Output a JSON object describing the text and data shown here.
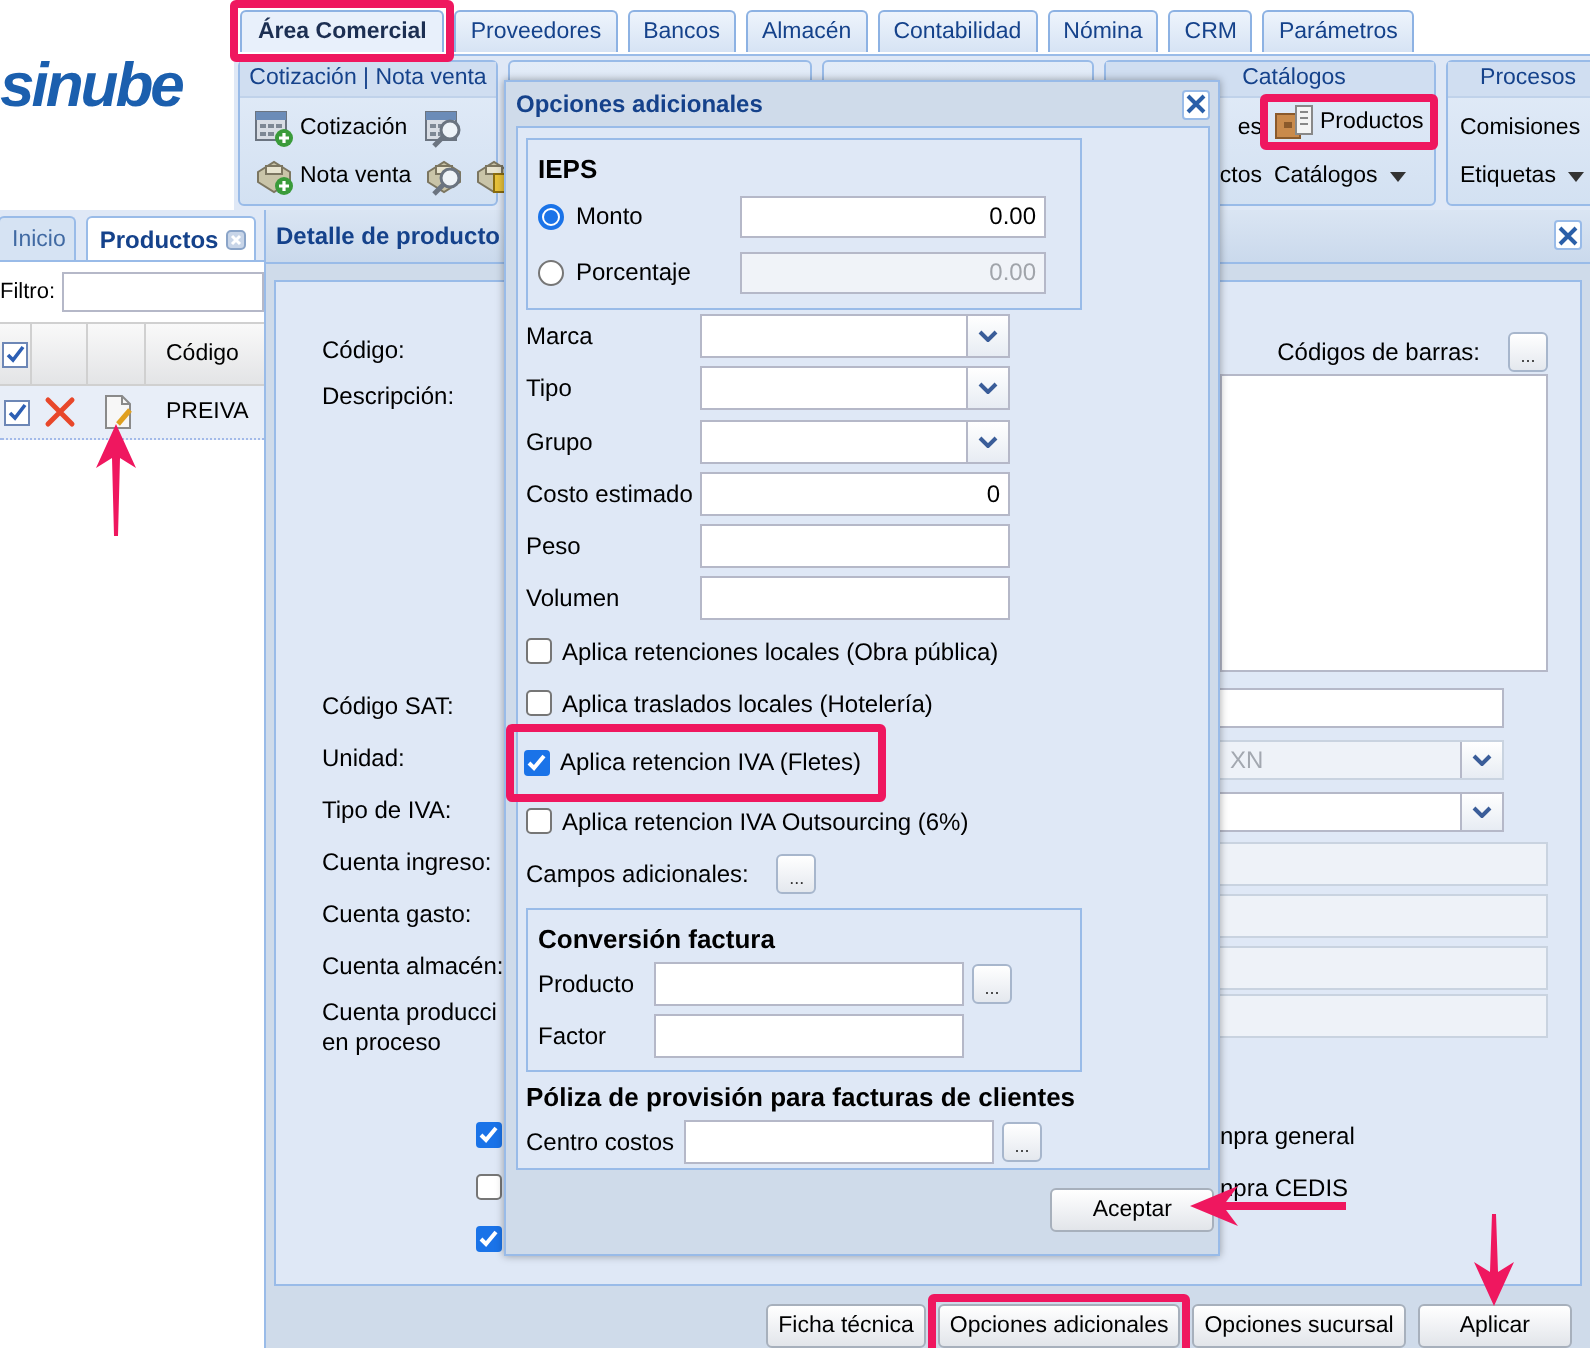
{
  "logo": "sinube",
  "main_tabs": [
    {
      "label": "Área Comercial",
      "selected": true,
      "highlighted": true
    },
    {
      "label": "Proveedores",
      "selected": false,
      "highlighted": false
    },
    {
      "label": "Bancos",
      "selected": false,
      "highlighted": false
    },
    {
      "label": "Almacén",
      "selected": false,
      "highlighted": false
    },
    {
      "label": "Contabilidad",
      "selected": false,
      "highlighted": false
    },
    {
      "label": "Nómina",
      "selected": false,
      "highlighted": false
    },
    {
      "label": "CRM",
      "selected": false,
      "highlighted": false
    },
    {
      "label": "Parámetros",
      "selected": false,
      "highlighted": false
    }
  ],
  "ribbon": {
    "groups": [
      {
        "kind": "quotes",
        "title": "Cotización | Nota venta",
        "items": [
          {
            "kind": "quote",
            "label": "Cotización",
            "highlighted": false
          },
          {
            "kind": "quote-search",
            "highlighted": false
          },
          {
            "kind": "sale",
            "label": "Nota venta",
            "highlighted": false
          },
          {
            "kind": "sale-search",
            "highlighted": false
          },
          {
            "kind": "sale-print",
            "highlighted": false
          }
        ]
      },
      {
        "kind": "covered"
      },
      {
        "kind": "covered"
      },
      {
        "kind": "catalogs",
        "title": "Catálogos",
        "items": [
          {
            "kind": "text",
            "label": "es",
            "highlighted": false
          },
          {
            "kind": "product",
            "label": "Productos",
            "highlighted": true
          },
          {
            "kind": "text",
            "label": "ctos",
            "highlighted": false
          },
          {
            "kind": "menu",
            "label": "Catálogos",
            "highlighted": false
          }
        ]
      },
      {
        "kind": "processes",
        "title": "Procesos",
        "items": [
          {
            "kind": "text",
            "label": "Comisiones",
            "highlighted": false
          },
          {
            "kind": "menu",
            "label": "Etiquetas",
            "highlighted": false
          }
        ]
      }
    ]
  },
  "side_panel": {
    "tabs": [
      {
        "label": "Inicio",
        "selected": false,
        "closable": false
      },
      {
        "label": "Productos",
        "selected": true,
        "closable": true
      }
    ],
    "filter": {
      "label": "Filtro:"
    },
    "columns": [
      {
        "kind": "check",
        "checked": true
      },
      {
        "kind": "blank"
      },
      {
        "kind": "blank"
      },
      {
        "kind": "text",
        "label": "Código"
      }
    ],
    "rows": [
      {
        "checked": true,
        "code": "PREIVA",
        "pointer": true
      }
    ]
  },
  "detail": {
    "title": "Detalle de producto",
    "rows": [
      {
        "kind": "barcode",
        "label": "Código:",
        "side_label": "Códigos de barras:",
        "button": "..."
      },
      {
        "kind": "textarea",
        "label": "Descripción:"
      },
      {
        "kind": "text",
        "label": "Código SAT:",
        "disabled": false
      },
      {
        "kind": "select",
        "label": "Unidad:",
        "value": "XN",
        "disabled": true
      },
      {
        "kind": "select",
        "label": "Tipo de IVA:",
        "disabled": false
      },
      {
        "kind": "account",
        "label": "Cuenta ingreso:",
        "disabled": true
      },
      {
        "kind": "account",
        "label": "Cuenta gasto:",
        "disabled": true
      },
      {
        "kind": "account",
        "label": "Cuenta almacén:",
        "disabled": true
      },
      {
        "kind": "account",
        "label": "Cuenta producci\nen proceso",
        "disabled": true
      }
    ],
    "checks": [
      {
        "checked": true,
        "label": "npra general"
      },
      {
        "checked": false,
        "label": "npra CEDIS"
      },
      {
        "checked": true
      }
    ],
    "buttons": [
      {
        "label": "Ficha técnica",
        "highlighted": false,
        "pointer": false
      },
      {
        "label": "Opciones adicionales",
        "highlighted": true,
        "pointer": false
      },
      {
        "label": "Opciones sucursal",
        "highlighted": false,
        "pointer": false
      },
      {
        "label": "Aplicar",
        "highlighted": false,
        "pointer": true
      }
    ]
  },
  "dialog": {
    "title": "Opciones adicionales",
    "ieps": {
      "title": "IEPS",
      "options": [
        {
          "label": "Monto",
          "selected": true,
          "value": "0.00"
        },
        {
          "label": "Porcentaje",
          "selected": false,
          "value": "0.00"
        }
      ]
    },
    "fields": [
      {
        "kind": "select",
        "label": "Marca"
      },
      {
        "kind": "select",
        "label": "Tipo"
      },
      {
        "kind": "select",
        "label": "Grupo"
      },
      {
        "kind": "text",
        "label": "Costo estimado",
        "value": "0"
      },
      {
        "kind": "text",
        "label": "Peso"
      },
      {
        "kind": "text",
        "label": "Volumen"
      }
    ],
    "checks": [
      {
        "label": "Aplica retenciones locales (Obra pública)",
        "checked": false,
        "highlighted": false
      },
      {
        "label": "Aplica traslados locales (Hotelería)",
        "checked": false,
        "highlighted": false
      },
      {
        "label": "Aplica retencion IVA (Fletes)",
        "checked": true,
        "highlighted": true
      },
      {
        "label": "Aplica retencion IVA Outsourcing (6%)",
        "checked": false,
        "highlighted": false
      }
    ],
    "extra": {
      "label": "Campos adicionales:",
      "button": "..."
    },
    "conversion": {
      "title": "Conversión factura",
      "fields": [
        {
          "label": "Producto",
          "button": "..."
        },
        {
          "label": "Factor"
        }
      ]
    },
    "policy": {
      "title": "Póliza de provisión para facturas de clientes",
      "fields": [
        {
          "label": "Centro costos",
          "button": "..."
        }
      ]
    },
    "buttons": [
      {
        "label": "Aceptar",
        "pointer": true
      }
    ]
  }
}
